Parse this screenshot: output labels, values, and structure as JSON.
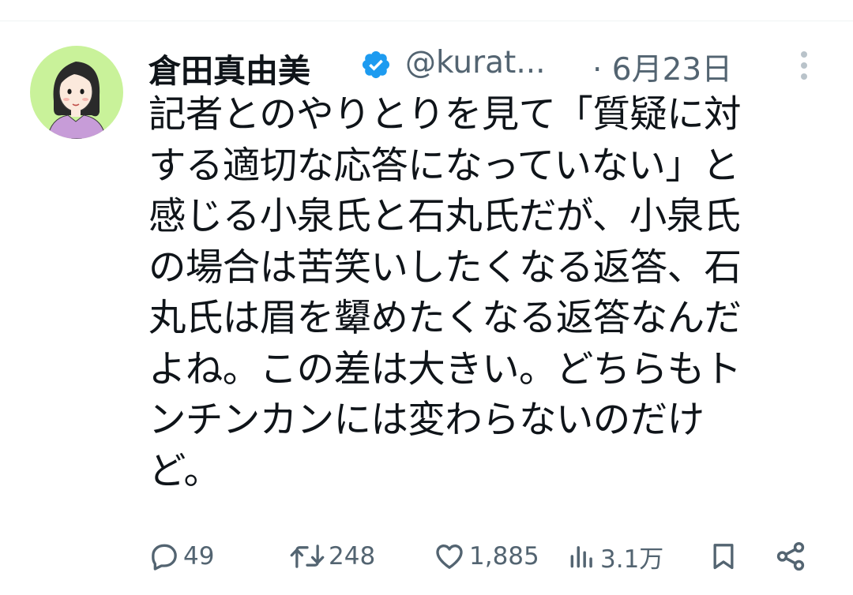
{
  "tweet": {
    "display_name": "倉田真由美",
    "handle": "@kurat...",
    "date": "· 6月23日",
    "verified": true,
    "text_lines": [
      "記者とのやりとりを見て「質疑に対",
      "する適切な応答になっていない」と",
      "感じる小泉氏と石丸氏だが、小泉氏",
      "の場合は苦笑いしたくなる返答、石",
      "丸氏は眉を顰めたくなる返答なんだ",
      "よね。この差は大きい。どちらもト",
      "ンチンカンには変わらないのだけ",
      "ど。"
    ]
  },
  "actions": {
    "replies": "49",
    "retweets": "248",
    "likes": "1,885",
    "views": "3.1万"
  },
  "icons": {
    "verified": "verified-badge-icon",
    "more": "more-vertical-icon",
    "reply": "reply-icon",
    "retweet": "retweet-icon",
    "like": "heart-icon",
    "views": "views-icon",
    "bookmark": "bookmark-icon",
    "share": "share-icon"
  },
  "colors": {
    "text": "#0f1419",
    "secondary": "#536471",
    "verified": "#1d9bf0",
    "avatar_bg": "#c9f29a"
  }
}
